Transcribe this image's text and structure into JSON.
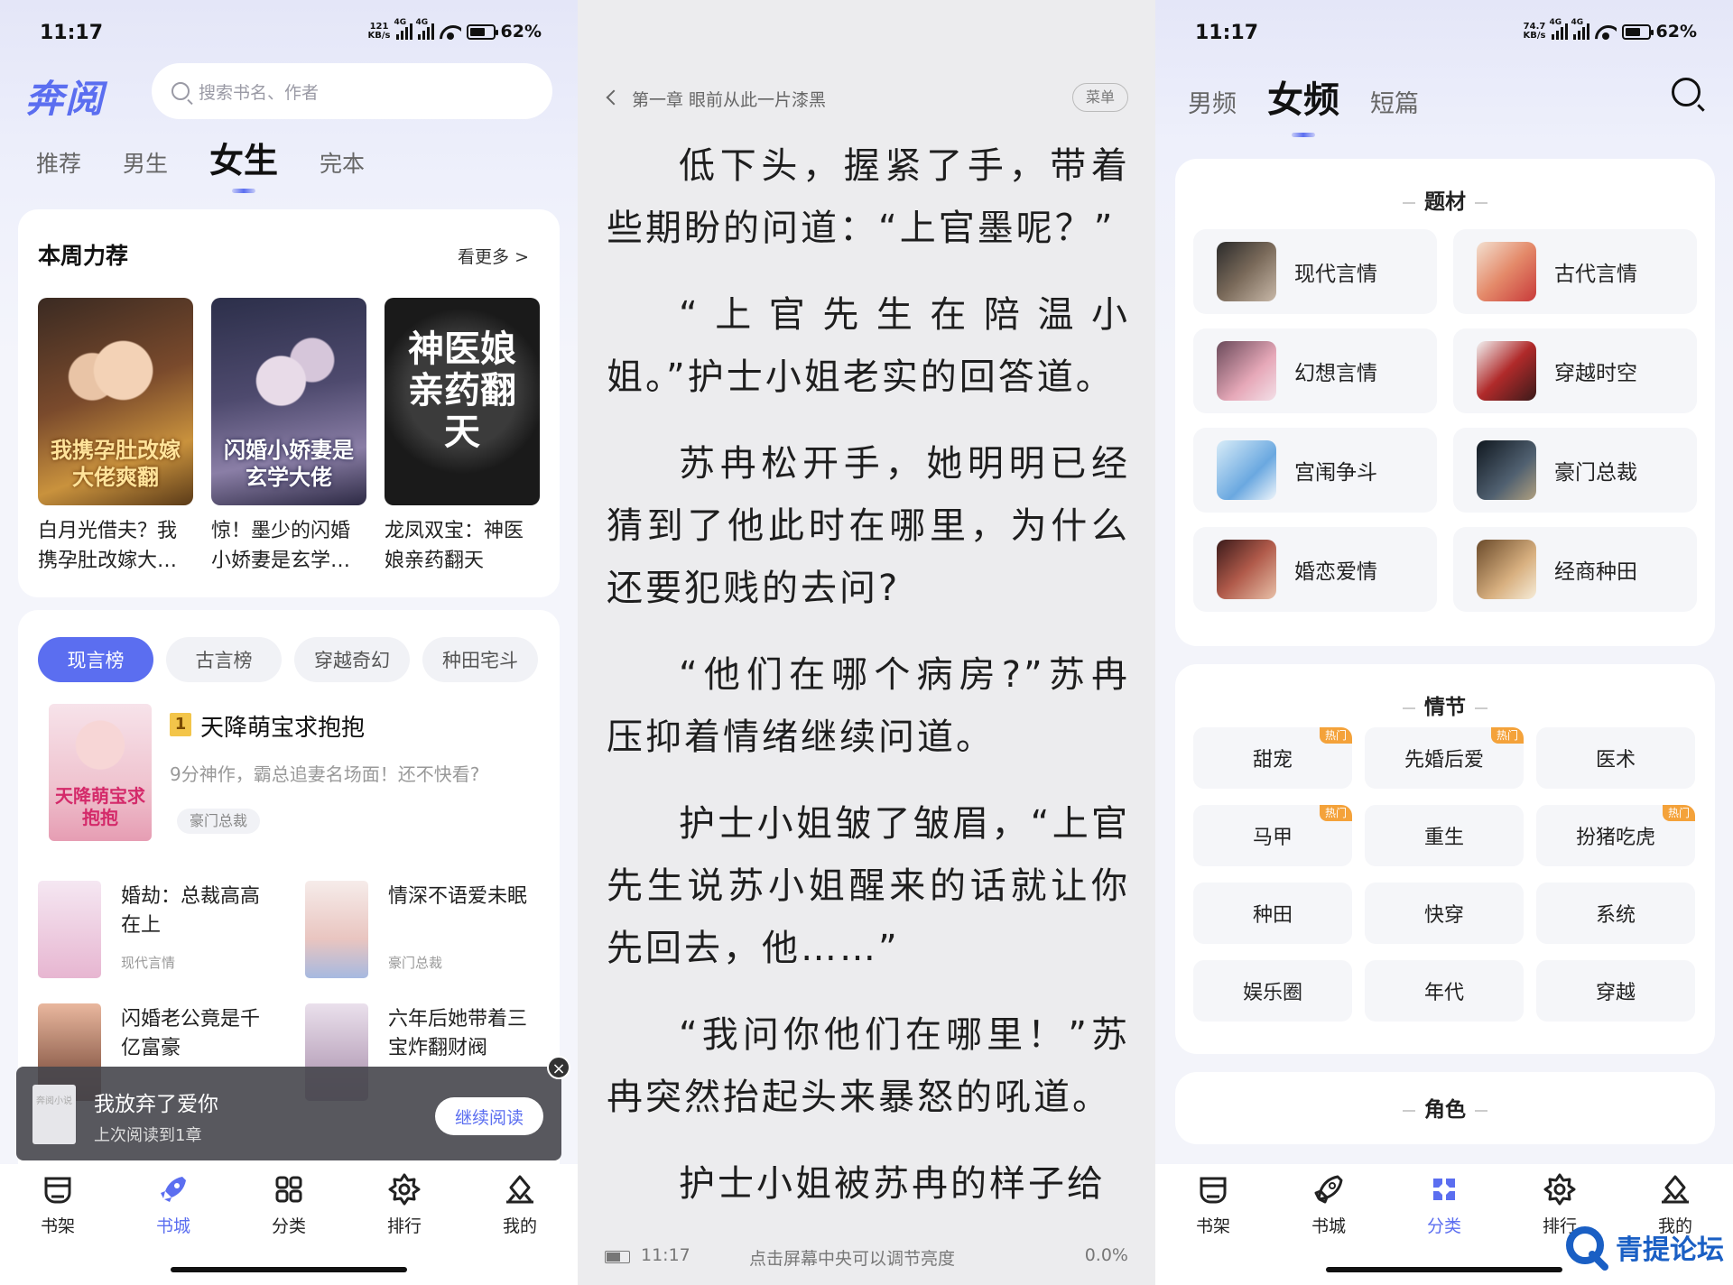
{
  "left": {
    "status": {
      "time": "11:17",
      "net_speed": "121",
      "net_unit": "KB/s",
      "sig1": "4G",
      "sig2": "4G",
      "battery": "62%"
    },
    "logo": "奔阅",
    "search_placeholder": "搜索书名、作者",
    "tabs": [
      "推荐",
      "男生",
      "女生",
      "完本"
    ],
    "weekly": {
      "title": "本周力荐",
      "more": "看更多 >",
      "books": [
        {
          "name": "白月光借夫？我携孕肚改嫁大…",
          "cover_title": "我携孕肚改嫁大佬爽翻"
        },
        {
          "name": "惊！墨少的闪婚小娇妻是玄学…",
          "cover_title": "闪婚小娇妻是玄学大佬"
        },
        {
          "name": "龙凤双宝：神医娘亲药翻天",
          "cover_title": "神医娘亲药翻天"
        }
      ]
    },
    "rank_tabs": [
      "现言榜",
      "古言榜",
      "穿越奇幻",
      "种田宅斗"
    ],
    "top1": {
      "rank": "1",
      "title": "天降萌宝求抱抱",
      "desc": "9分神作，霸总追妻名场面！还不快看?",
      "tag": "豪门总裁",
      "cover_title": "天降萌宝求抱抱"
    },
    "items": [
      {
        "title": "婚劫：总裁高高在上",
        "sub": "现代言情"
      },
      {
        "title": "情深不语爱未眠",
        "sub": "豪门总裁"
      },
      {
        "title": "闪婚老公竟是千亿富豪",
        "sub": ""
      },
      {
        "title": "六年后她带着三宝炸翻财阀",
        "sub": ""
      }
    ],
    "toast": {
      "title": "我放弃了爱你",
      "sub": "上次阅读到1章",
      "button": "继续阅读",
      "thumb": "奔阅小说"
    },
    "nav": [
      "书架",
      "书城",
      "分类",
      "排行",
      "我的"
    ]
  },
  "reader": {
    "chapter": "第一章 眼前从此一片漆黑",
    "menu": "菜单",
    "paragraphs": [
      "低下头，握紧了手，带着些期盼的问道：“上官墨呢？”",
      "“上官先生在陪温小姐。”护士小姐老实的回答道。",
      "苏冉松开手，她明明已经猜到了他此时在哪里，为什么还要犯贱的去问?",
      "“他们在哪个病房?”苏冉压抑着情绪继续问道。",
      "护士小姐皱了皱眉，“上官先生说苏小姐醒来的话就让你先回去，他……”",
      "“我问你他们在哪里！”苏冉突然抬起头来暴怒的吼道。",
      "护士小姐被苏冉的样子给"
    ],
    "footer": {
      "time": "11:17",
      "hint": "点击屏幕中央可以调节亮度",
      "progress": "0.0%"
    }
  },
  "right": {
    "status": {
      "time": "11:17",
      "net_speed": "74.7",
      "net_unit": "KB/s",
      "sig1": "4G",
      "sig2": "4G",
      "battery": "62%"
    },
    "tabs": [
      "男频",
      "女频",
      "短篇"
    ],
    "genre_title": "题材",
    "genres": [
      "现代言情",
      "古代言情",
      "幻想言情",
      "穿越时空",
      "宫闱争斗",
      "豪门总裁",
      "婚恋爱情",
      "经商种田"
    ],
    "plot_title": "情节",
    "plots": [
      {
        "label": "甜宠",
        "hot": "热门"
      },
      {
        "label": "先婚后爱",
        "hot": "热门"
      },
      {
        "label": "医术",
        "hot": ""
      },
      {
        "label": "马甲",
        "hot": "热门"
      },
      {
        "label": "重生",
        "hot": ""
      },
      {
        "label": "扮猪吃虎",
        "hot": "热门"
      },
      {
        "label": "种田",
        "hot": ""
      },
      {
        "label": "快穿",
        "hot": ""
      },
      {
        "label": "系统",
        "hot": ""
      },
      {
        "label": "娱乐圈",
        "hot": ""
      },
      {
        "label": "年代",
        "hot": ""
      },
      {
        "label": "穿越",
        "hot": ""
      }
    ],
    "role_title": "角色",
    "nav": [
      "书架",
      "书城",
      "分类",
      "排行",
      "我的"
    ],
    "watermark": "青提论坛"
  },
  "colors": {
    "accent": "#5b6ef0",
    "hot": "#f4a23a"
  }
}
